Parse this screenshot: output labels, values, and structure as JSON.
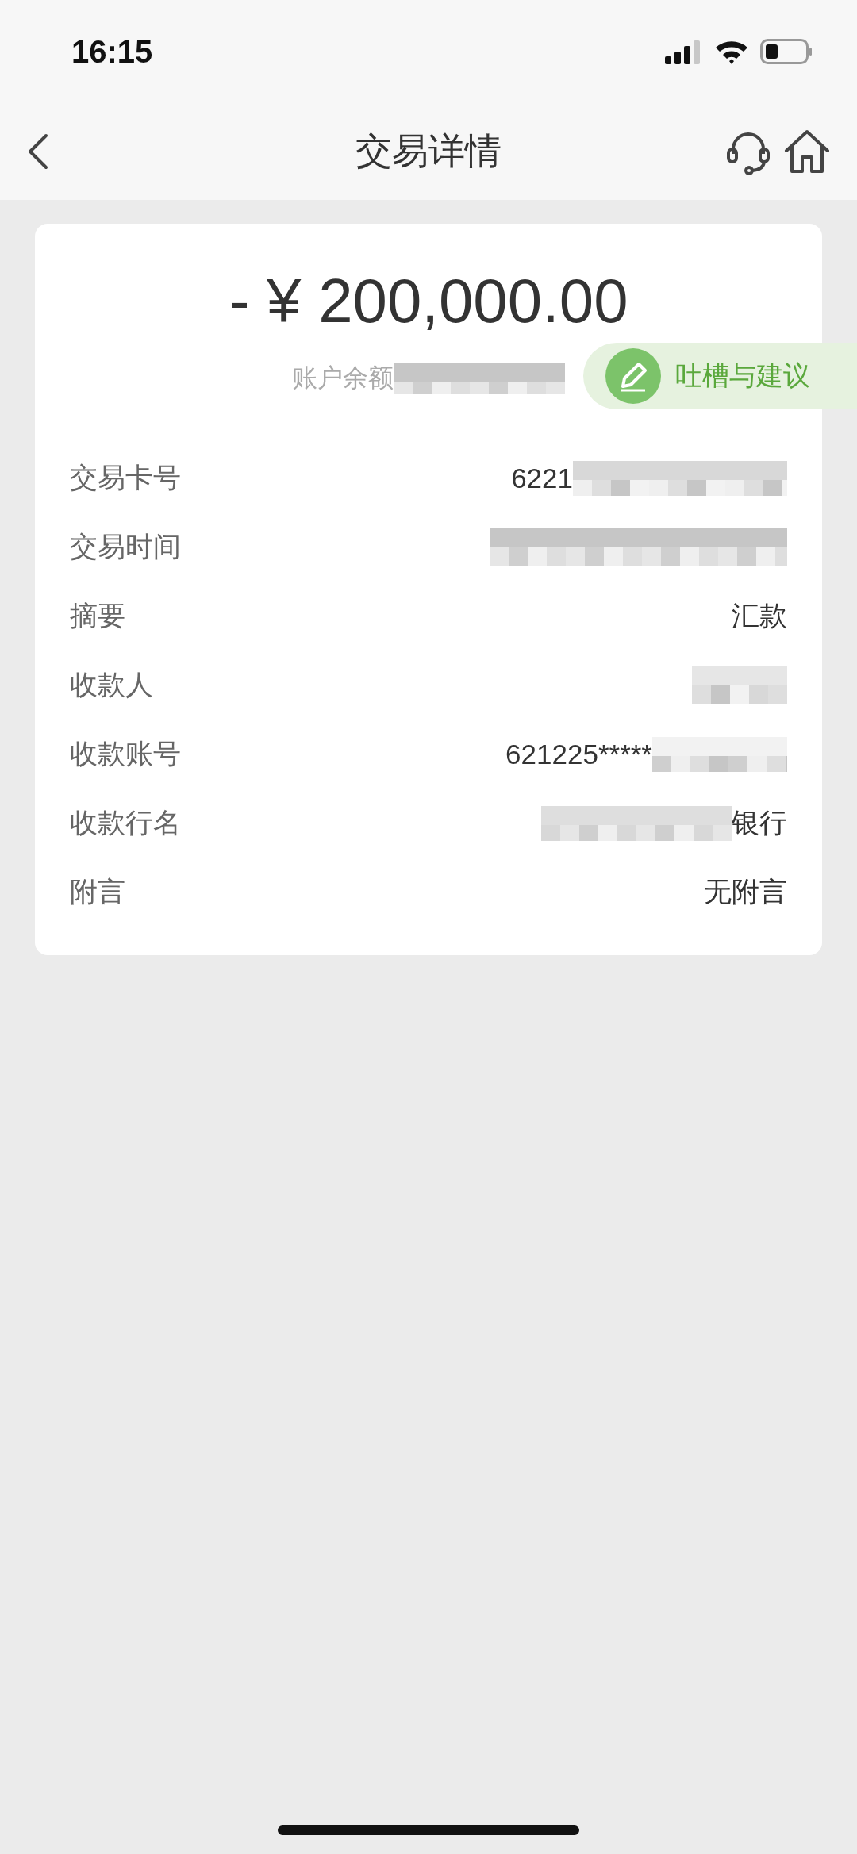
{
  "status_bar": {
    "time": "16:15"
  },
  "nav": {
    "title": "交易详情"
  },
  "amount": "- ¥ 200,000.00",
  "balance": {
    "label": "账户余额",
    "kind": "masked_after"
  },
  "feedback": {
    "label": "吐槽与建议"
  },
  "rows": [
    {
      "label": "交易卡号",
      "value": "6221",
      "kind": "masked_after"
    },
    {
      "label": "交易时间",
      "kind": "masked"
    },
    {
      "label": "摘要",
      "value": "汇款",
      "kind": "plain"
    },
    {
      "label": "收款人",
      "kind": "masked"
    },
    {
      "label": "收款账号",
      "value": "621225*****",
      "kind": "masked_after"
    },
    {
      "label": "收款行名",
      "value": "银行",
      "kind": "masked_before"
    },
    {
      "label": "附言",
      "value": "无附言",
      "kind": "plain"
    }
  ]
}
